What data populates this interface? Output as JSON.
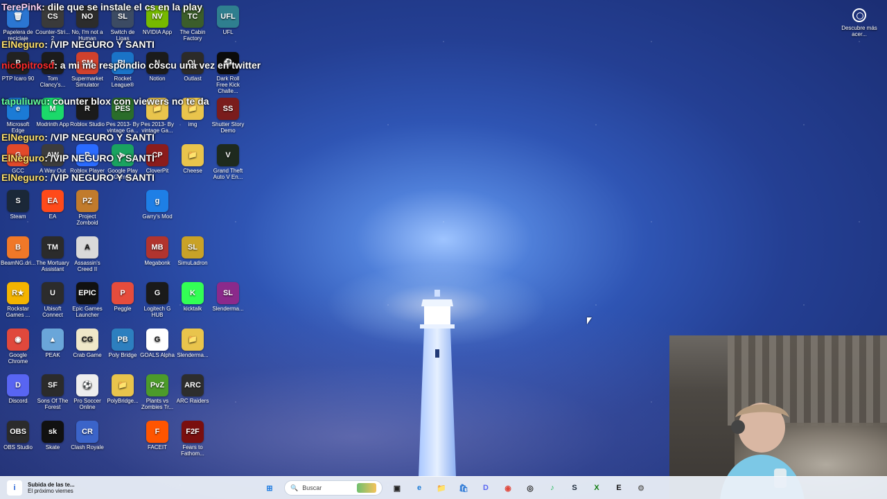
{
  "desktop": {
    "icons": [
      {
        "name": "recycle-bin-icon",
        "label": "Papelera de reciclaje",
        "icon_text": "🗑",
        "color": "#2b76d2"
      },
      {
        "name": "counter-strike-icon",
        "label": "Counter-Stri... 2",
        "icon_text": "CS",
        "color": "#3a3a3a"
      },
      {
        "name": "no-im-not-a-human-icon",
        "label": "No, I'm not a Human",
        "icon_text": "NO",
        "color": "#2c2c2c"
      },
      {
        "name": "switch-de-ligas-icon",
        "label": "Switch de Ligas",
        "icon_text": "SL",
        "color": "#3c4b63"
      },
      {
        "name": "nvidia-app-icon",
        "label": "NVIDIA App",
        "icon_text": "NV",
        "color": "#76b900"
      },
      {
        "name": "the-cabin-factory-icon",
        "label": "The Cabin Factory",
        "icon_text": "TC",
        "color": "#3b5d2a"
      },
      {
        "name": "ufl-icon",
        "label": "UFL",
        "icon_text": "UFL",
        "color": "#2f7f8f"
      },
      {
        "name": "ptp-icaro-icon",
        "label": "PTP Icaro 90",
        "icon_text": "P",
        "color": "#222"
      },
      {
        "name": "tom-clancys-icon",
        "label": "Tom Clancy's...",
        "icon_text": "6",
        "color": "#1c1c1c"
      },
      {
        "name": "supermarket-simulator-icon",
        "label": "Supermarket Simulator",
        "icon_text": "SM",
        "color": "#d0412d"
      },
      {
        "name": "rocket-league-icon",
        "label": "Rocket League®",
        "icon_text": "RL",
        "color": "#1a73c7"
      },
      {
        "name": "notion-icon",
        "label": "Notion",
        "icon_text": "N",
        "color": "#1b1b1b"
      },
      {
        "name": "outlast-icon",
        "label": "Outlast",
        "icon_text": "OL",
        "color": "#2c2b29"
      },
      {
        "name": "dark-roll-free-kick-challenge-icon",
        "label": "Dark Roll Free Kick Challe...",
        "icon_text": "⚽",
        "color": "#0b0b0b"
      },
      {
        "name": "microsoft-edge-icon",
        "label": "Microsoft Edge",
        "icon_text": "e",
        "color": "#1b7bd6"
      },
      {
        "name": "modrinth-app-icon",
        "label": "Modrinth App",
        "icon_text": "M",
        "color": "#1bd96a"
      },
      {
        "name": "roblox-studio-icon",
        "label": "Roblox Studio",
        "icon_text": "R",
        "color": "#1b1b1b"
      },
      {
        "name": "pes-2013-vintage-gaming-icon-1",
        "label": "Pes 2013- By vintage Ga...",
        "icon_text": "PES",
        "color": "#2a6d2a"
      },
      {
        "name": "pes-2013-vintage-gaming-icon-2",
        "label": "Pes 2013- By vintage Ga...",
        "icon_text": "📁",
        "color": "#e9c44c"
      },
      {
        "name": "img-folder-icon",
        "label": "img",
        "icon_text": "📁",
        "color": "#e9c44c"
      },
      {
        "name": "shutter-story-demo-icon",
        "label": "Shutter Story Demo",
        "icon_text": "SS",
        "color": "#7a1c1c"
      },
      {
        "name": "gcc-icon",
        "label": "GCC",
        "icon_text": "G",
        "color": "#e2492a"
      },
      {
        "name": "a-way-out-icon",
        "label": "A Way Out",
        "icon_text": "AW",
        "color": "#3c3c3c"
      },
      {
        "name": "roblox-player-icon",
        "label": "Roblox Player",
        "icon_text": "R",
        "color": "#2a6bff"
      },
      {
        "name": "google-play-games-icon",
        "label": "Google Play Games",
        "icon_text": "▶",
        "color": "#1aa360"
      },
      {
        "name": "cloverpit-icon",
        "label": "CloverPit",
        "icon_text": "CP",
        "color": "#8b1c1c"
      },
      {
        "name": "cheese-folder-icon",
        "label": "Cheese",
        "icon_text": "📁",
        "color": "#e9c44c"
      },
      {
        "name": "grand-theft-auto-v-icon",
        "label": "Grand Theft Auto V En...",
        "icon_text": "V",
        "color": "#1e2a1e"
      },
      {
        "name": "steam-icon",
        "label": "Steam",
        "icon_text": "S",
        "color": "#1b2838"
      },
      {
        "name": "ea-icon",
        "label": "EA",
        "icon_text": "EA",
        "color": "#ff4a1a"
      },
      {
        "name": "project-zomboid-icon",
        "label": "Project Zomboid",
        "icon_text": "PZ",
        "color": "#c17b2c"
      },
      {
        "name": "garrys-mod-icon",
        "label": "Garry's Mod",
        "icon_text": "g",
        "color": "#1e7fe6"
      },
      {
        "name": "beamng-drive-icon",
        "label": "BeamNG.dri...",
        "icon_text": "B",
        "color": "#f07828"
      },
      {
        "name": "the-mortuary-assistant-icon",
        "label": "The Mortuary Assistant",
        "icon_text": "TM",
        "color": "#2b2b2b"
      },
      {
        "name": "assassins-creed-ii-icon",
        "label": "Assassin's Creed II",
        "icon_text": "A",
        "color": "#d9d9d9"
      },
      {
        "name": "megabonk-icon",
        "label": "Megabonk",
        "icon_text": "MB",
        "color": "#b1342e"
      },
      {
        "name": "simuladron-icon",
        "label": "SimuLadron",
        "icon_text": "SL",
        "color": "#c9a227"
      },
      {
        "name": "rockstar-games-launcher-icon",
        "label": "Rockstar Games ...",
        "icon_text": "R★",
        "color": "#f4b400"
      },
      {
        "name": "ubisoft-connect-icon",
        "label": "Ubisoft Connect",
        "icon_text": "U",
        "color": "#2c2c2c"
      },
      {
        "name": "epic-games-launcher-icon",
        "label": "Epic Games Launcher",
        "icon_text": "EPIC",
        "color": "#111"
      },
      {
        "name": "peggle-icon",
        "label": "Peggle",
        "icon_text": "P",
        "color": "#e64c3c"
      },
      {
        "name": "logitech-g-hub-icon",
        "label": "Logitech G HUB",
        "icon_text": "G",
        "color": "#1a1a1a"
      },
      {
        "name": "kicktalk-icon",
        "label": "kicktalk",
        "icon_text": "K",
        "color": "#33ff55"
      },
      {
        "name": "slenderman-icon-1",
        "label": "Slenderma...",
        "icon_text": "SL",
        "color": "#8b2a8b"
      },
      {
        "name": "google-chrome-icon",
        "label": "Google Chrome",
        "icon_text": "◉",
        "color": "#e0483c"
      },
      {
        "name": "peak-icon",
        "label": "PEAK",
        "icon_text": "▲",
        "color": "#6aa6d9"
      },
      {
        "name": "crab-game-icon",
        "label": "Crab Game",
        "icon_text": "CG",
        "color": "#f0e8c9"
      },
      {
        "name": "poly-bridge-icon",
        "label": "Poly Bridge",
        "icon_text": "PB",
        "color": "#2d7fbf"
      },
      {
        "name": "goals-alpha-icon",
        "label": "GOALS Alpha",
        "icon_text": "G",
        "color": "#fff"
      },
      {
        "name": "slenderman-folder-icon",
        "label": "Slenderma...",
        "icon_text": "📁",
        "color": "#e9c44c"
      },
      {
        "name": "discord-icon",
        "label": "Discord",
        "icon_text": "D",
        "color": "#5865f2"
      },
      {
        "name": "sons-of-the-forest-icon",
        "label": "Sons Of The Forest",
        "icon_text": "SF",
        "color": "#2b2b2b"
      },
      {
        "name": "pro-soccer-online-icon",
        "label": "Pro Soccer Online",
        "icon_text": "⚽",
        "color": "#eee"
      },
      {
        "name": "polybridge-folder-icon",
        "label": "PolyBridge...",
        "icon_text": "📁",
        "color": "#e9c44c"
      },
      {
        "name": "plants-vs-zombies-icon",
        "label": "Plants vs Zombies Tr...",
        "icon_text": "PvZ",
        "color": "#4c9b2a"
      },
      {
        "name": "arc-raiders-icon",
        "label": "ARC Raiders",
        "icon_text": "ARC",
        "color": "#2d2d2d"
      },
      {
        "name": "obs-studio-icon",
        "label": "OBS Studio",
        "icon_text": "OBS",
        "color": "#2b2b2b"
      },
      {
        "name": "skate-icon",
        "label": "Skate",
        "icon_text": "sk",
        "color": "#111"
      },
      {
        "name": "clash-royale-icon",
        "label": "Clash Royale",
        "icon_text": "CR",
        "color": "#3b64c9"
      },
      {
        "name": "faceit-icon",
        "label": "FACEIT",
        "icon_text": "F",
        "color": "#ff5500"
      },
      {
        "name": "fears-to-fathom-icon",
        "label": "Fears to Fathom...",
        "icon_text": "F2F",
        "color": "#7a0f0f"
      }
    ]
  },
  "chat_overlay": {
    "lines": [
      {
        "user": "TerePink",
        "user_color": "pink",
        "message": ": dile que se instale el cs en la play"
      },
      {
        "user": "ElNeguro",
        "user_color": "yellow",
        "message": ": /VIP NEGURO Y SANTI"
      },
      {
        "user": "nicopitrosd",
        "user_color": "red",
        "message": ": a mi me respondio coscu una vez en twitter"
      },
      {
        "user": "tapuliuwu",
        "user_color": "green",
        "message": ": counter blox con viewers no te da"
      },
      {
        "user": "ElNeguro",
        "user_color": "yellow",
        "message": ": /VIP NEGURO Y SANTI"
      },
      {
        "user": "ElNeguro",
        "user_color": "yellow",
        "message": ": /VIP NEGURO Y SANTI"
      },
      {
        "user": "ElNeguro",
        "user_color": "yellow",
        "message": ": /VIP NEGURO Y SANTI"
      }
    ]
  },
  "discover": {
    "label": "Descubre más acer..."
  },
  "taskbar": {
    "left_title": "Subida de las te...",
    "left_subtitle": "El próximo viernes",
    "search_placeholder": "Buscar",
    "app_icons": [
      {
        "name": "windows-start-icon",
        "text": "⊞",
        "color": "#1e7be0"
      },
      {
        "name": "task-view-icon",
        "text": "▣",
        "color": "#222"
      },
      {
        "name": "edge-taskbar-icon",
        "text": "e",
        "color": "#1b7bd6"
      },
      {
        "name": "file-explorer-taskbar-icon",
        "text": "📁",
        "color": "#e9c44c"
      },
      {
        "name": "microsoft-store-taskbar-icon",
        "text": "🛍",
        "color": "#2b78d6"
      },
      {
        "name": "discord-taskbar-icon",
        "text": "D",
        "color": "#5865f2"
      },
      {
        "name": "chrome-taskbar-icon",
        "text": "◉",
        "color": "#e0483c"
      },
      {
        "name": "obs-taskbar-icon",
        "text": "◎",
        "color": "#2b2b2b"
      },
      {
        "name": "spotify-taskbar-icon",
        "text": "♪",
        "color": "#1db954"
      },
      {
        "name": "steam-taskbar-icon",
        "text": "S",
        "color": "#1b2838"
      },
      {
        "name": "xbox-taskbar-icon",
        "text": "X",
        "color": "#107c10"
      },
      {
        "name": "epic-taskbar-icon",
        "text": "E",
        "color": "#111"
      },
      {
        "name": "settings-taskbar-icon",
        "text": "⚙",
        "color": "#6b6b6b"
      }
    ]
  }
}
